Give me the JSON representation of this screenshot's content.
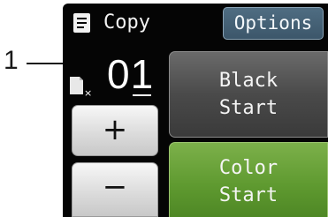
{
  "callout": {
    "label": "1"
  },
  "header": {
    "title": "Copy",
    "options_label": "Options"
  },
  "copies": {
    "count": "01",
    "multiplier_glyph": "×"
  },
  "stepper": {
    "plus_label": "+",
    "minus_label": "−"
  },
  "buttons": {
    "black_start": {
      "line1": "Black",
      "line2": "Start"
    },
    "color_start": {
      "line1": "Color",
      "line2": "Start"
    }
  },
  "colors": {
    "screen_bg": "#050505",
    "options_bg": "#46627a",
    "black_btn": "#4a4a4a",
    "color_btn": "#5f9a30",
    "stepper_btn": "#dcdcdc"
  },
  "icons": {
    "header_icon": "copy-document-icon",
    "count_icon": "paper-copies-icon"
  }
}
